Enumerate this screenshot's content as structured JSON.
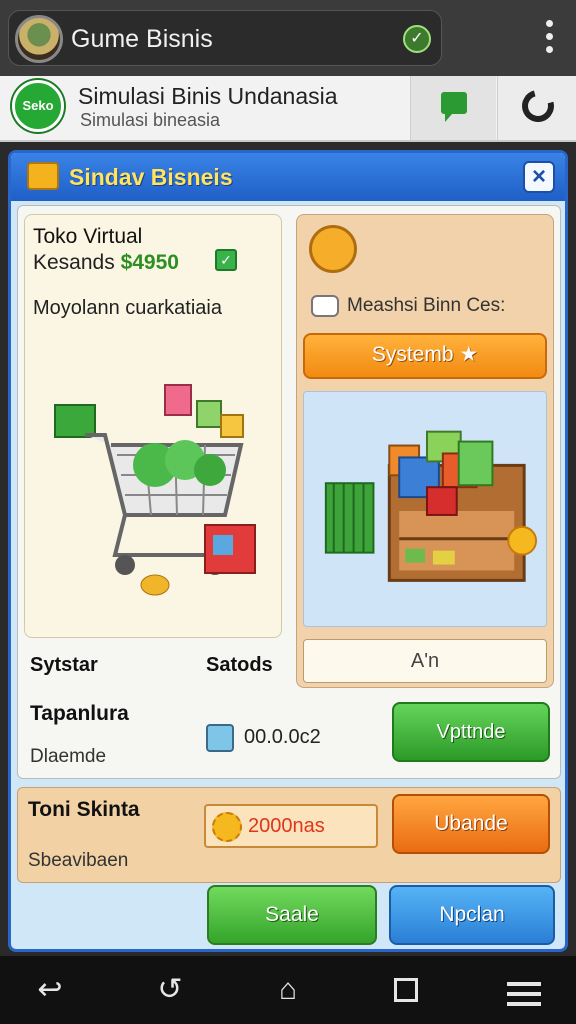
{
  "topbar": {
    "app_title": "Gume Bisnis"
  },
  "header": {
    "logo_text": "Seko",
    "title": "Simulasi Binis Undanasia",
    "subtitle": "Simulasi bineasia"
  },
  "panel": {
    "title": "Sindav Bisneis",
    "close_label": "×"
  },
  "left_card": {
    "title": "Toko Virtual",
    "keuntungan_label": "Kesands",
    "keuntungan_value": "$4950",
    "description": "Moyolann cuarkatiaia"
  },
  "right_card": {
    "info_label": "Meashsi Binn Ces:",
    "system_button": "Systemb ★",
    "field_value": "A'n"
  },
  "stats": {
    "label_a": "Sytstar",
    "label_b": "Satods",
    "row_label": "Tapanlura",
    "row_sub": "Dlaemde",
    "money_value": "00.0.0c2",
    "upgrade_button": "Vpttnde"
  },
  "orange_row": {
    "title": "Toni Skinta",
    "subtitle": "Sbeavibaen",
    "value": "2000nas",
    "button": "Ubande"
  },
  "bottom_buttons": {
    "sale": "Saale",
    "other": "Npclan"
  },
  "colors": {
    "header_blue": "#1f5fc7",
    "panel_title_yellow": "#ffe45c",
    "green_button": "#2d9a28",
    "orange_button": "#ea6c12",
    "blue_button": "#2a7fd6"
  }
}
